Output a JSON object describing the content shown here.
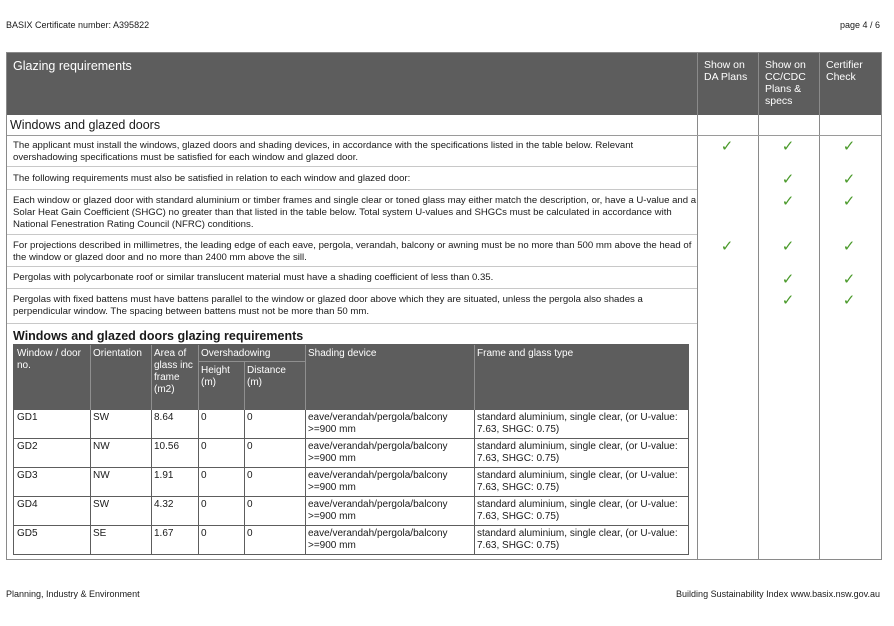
{
  "header": {
    "certificate": "BASIX Certificate number: A395822",
    "page": "page 4 / 6"
  },
  "section": {
    "title": "Glazing requirements",
    "columns": [
      "Show on DA Plans",
      "Show on CC/CDC Plans & specs",
      "Certifier Check"
    ],
    "subtitle": "Windows and glazed doors"
  },
  "requirements": [
    {
      "text": "The applicant must install the windows, glazed doors and shading devices, in accordance with the specifications listed in the table below. Relevant overshadowing specifications must be satisfied for each window and glazed door.",
      "da": true,
      "cc": true,
      "cert": true
    },
    {
      "text": "The following requirements must also be satisfied in relation to each window and glazed door:",
      "da": false,
      "cc": true,
      "cert": true
    },
    {
      "text": "Each window or glazed door with standard aluminium or timber frames and single clear or toned glass may either match the description, or, have a U-value and a Solar Heat Gain Coefficient (SHGC) no greater than that listed in the table below. Total system U-values and SHGCs must be calculated in accordance with National Fenestration Rating Council (NFRC) conditions.",
      "da": false,
      "cc": true,
      "cert": true
    },
    {
      "text": "For projections described in millimetres, the leading edge of each eave, pergola, verandah, balcony or awning must be no more than 500 mm above the head of the window or glazed door and no more than 2400 mm above the sill.",
      "da": true,
      "cc": true,
      "cert": true
    },
    {
      "text": "Pergolas with polycarbonate roof or similar translucent material must have a shading coefficient of less than 0.35.",
      "da": false,
      "cc": true,
      "cert": true
    },
    {
      "text": "Pergolas with fixed battens must have battens parallel to the window or glazed door above which they are situated, unless the pergola also shades a perpendicular window. The spacing between battens must not be more than 50 mm.",
      "da": false,
      "cc": true,
      "cert": true
    }
  ],
  "tick_symbol": "✓",
  "table": {
    "title": "Windows and glazed doors glazing requirements",
    "headers": {
      "window": "Window / door no.",
      "orientation": "Orientation",
      "area": "Area of glass inc frame (m2)",
      "overshadowing": "Overshadowing",
      "height": "Height (m)",
      "distance": "Distance (m)",
      "shading": "Shading device",
      "frame": "Frame and glass type"
    },
    "rows": [
      {
        "id": "GD1",
        "orientation": "SW",
        "area": "8.64",
        "height": "0",
        "distance": "0",
        "shading": "eave/verandah/pergola/balcony >=900 mm",
        "frame": "standard aluminium, single clear, (or U-value: 7.63, SHGC: 0.75)"
      },
      {
        "id": "GD2",
        "orientation": "NW",
        "area": "10.56",
        "height": "0",
        "distance": "0",
        "shading": "eave/verandah/pergola/balcony >=900 mm",
        "frame": "standard aluminium, single clear, (or U-value: 7.63, SHGC: 0.75)"
      },
      {
        "id": "GD3",
        "orientation": "NW",
        "area": "1.91",
        "height": "0",
        "distance": "0",
        "shading": "eave/verandah/pergola/balcony >=900 mm",
        "frame": "standard aluminium, single clear, (or U-value: 7.63, SHGC: 0.75)"
      },
      {
        "id": "GD4",
        "orientation": "SW",
        "area": "4.32",
        "height": "0",
        "distance": "0",
        "shading": "eave/verandah/pergola/balcony >=900 mm",
        "frame": "standard aluminium, single clear, (or U-value: 7.63, SHGC: 0.75)"
      },
      {
        "id": "GD5",
        "orientation": "SE",
        "area": "1.67",
        "height": "0",
        "distance": "0",
        "shading": "eave/verandah/pergola/balcony >=900 mm",
        "frame": "standard aluminium, single clear, (or U-value: 7.63, SHGC: 0.75)"
      }
    ]
  },
  "footer": {
    "left": "Planning, Industry & Environment",
    "right": "Building Sustainability Index www.basix.nsw.gov.au"
  },
  "colors": {
    "header_gray": "#5d5d5d",
    "tick_green": "#4a9a2a"
  }
}
